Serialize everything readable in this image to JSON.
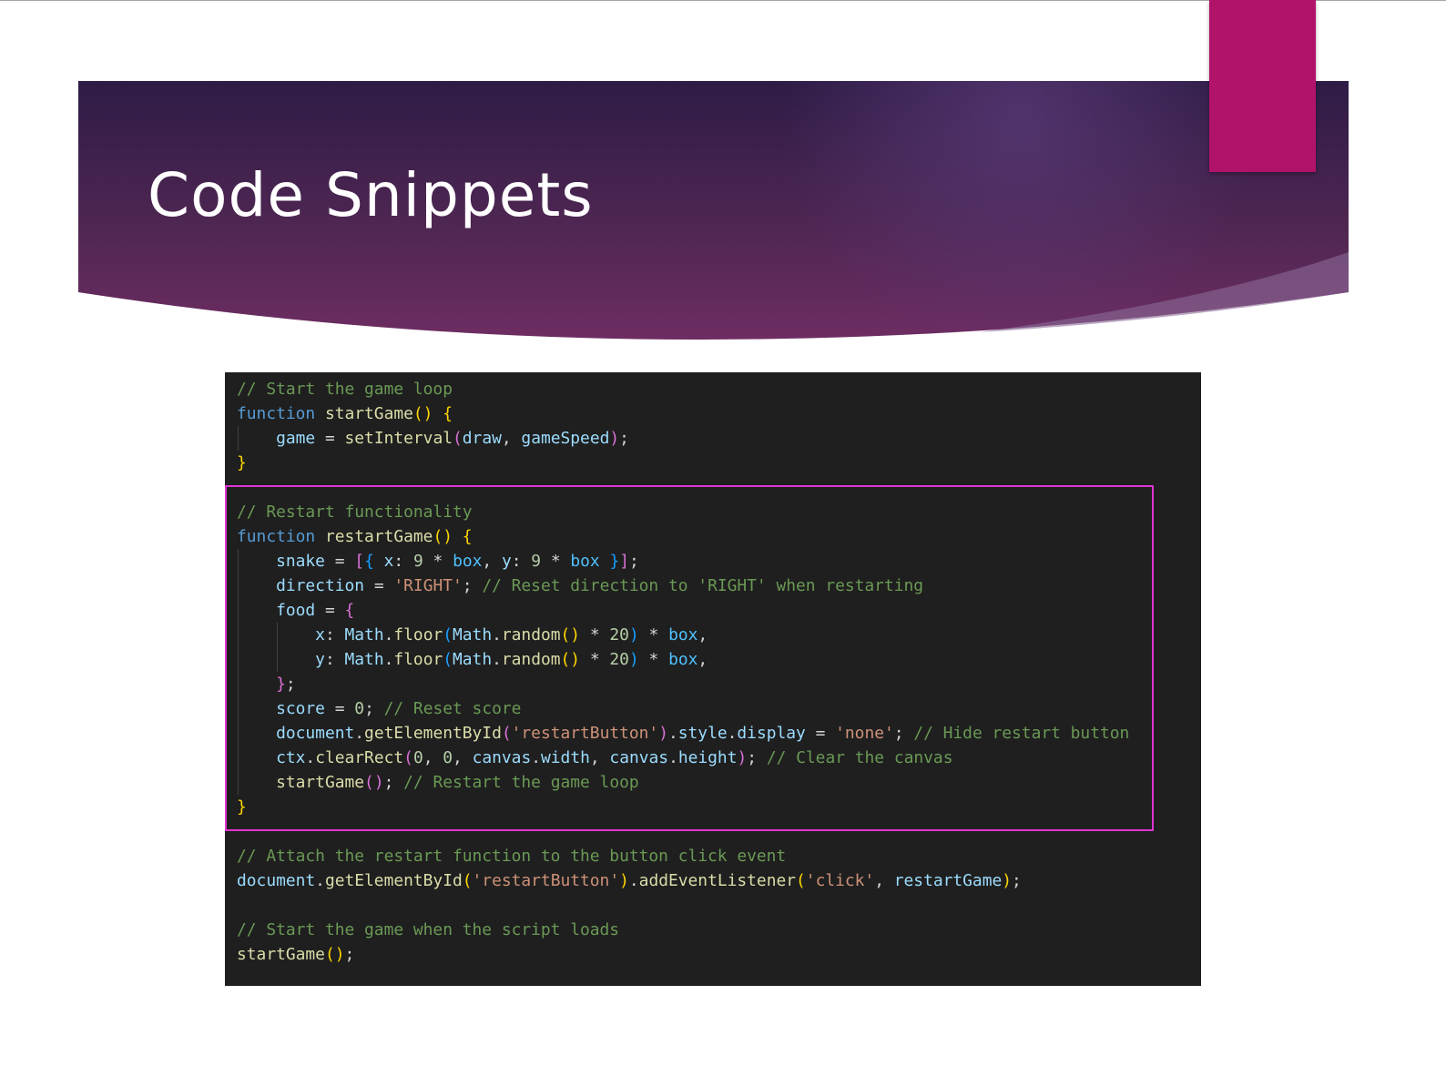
{
  "slide": {
    "title": "Code Snippets",
    "colors": {
      "banner_dark": "#2e1c46",
      "banner_mid": "#6a2c62",
      "accent_tab": "#b1136a",
      "highlight_border": "#e034d3",
      "code_background": "#1f1f1f"
    }
  },
  "code": {
    "language": "javascript",
    "lines": [
      [
        {
          "t": "// Start the game loop",
          "c": "cmt"
        }
      ],
      [
        {
          "t": "function",
          "c": "kw"
        },
        {
          "t": " "
        },
        {
          "t": "startGame",
          "c": "fn"
        },
        {
          "t": "()",
          "c": "b1"
        },
        {
          "t": " "
        },
        {
          "t": "{",
          "c": "b1"
        }
      ],
      [
        {
          "t": "    "
        },
        {
          "t": "game",
          "c": "var"
        },
        {
          "t": " = "
        },
        {
          "t": "setInterval",
          "c": "fn"
        },
        {
          "t": "(",
          "c": "b2"
        },
        {
          "t": "draw",
          "c": "var"
        },
        {
          "t": ", "
        },
        {
          "t": "gameSpeed",
          "c": "var"
        },
        {
          "t": ")",
          "c": "b2"
        },
        {
          "t": ";"
        }
      ],
      [
        {
          "t": "}",
          "c": "b1"
        }
      ],
      [],
      [
        {
          "t": "// Restart functionality",
          "c": "cmt"
        }
      ],
      [
        {
          "t": "function",
          "c": "kw"
        },
        {
          "t": " "
        },
        {
          "t": "restartGame",
          "c": "fn"
        },
        {
          "t": "()",
          "c": "b1"
        },
        {
          "t": " "
        },
        {
          "t": "{",
          "c": "b1"
        }
      ],
      [
        {
          "t": "    "
        },
        {
          "t": "snake",
          "c": "var"
        },
        {
          "t": " = "
        },
        {
          "t": "[",
          "c": "b2"
        },
        {
          "t": "{",
          "c": "b3"
        },
        {
          "t": " "
        },
        {
          "t": "x",
          "c": "var"
        },
        {
          "t": ": "
        },
        {
          "t": "9",
          "c": "num"
        },
        {
          "t": " * "
        },
        {
          "t": "box",
          "c": "const"
        },
        {
          "t": ", "
        },
        {
          "t": "y",
          "c": "var"
        },
        {
          "t": ": "
        },
        {
          "t": "9",
          "c": "num"
        },
        {
          "t": " * "
        },
        {
          "t": "box",
          "c": "const"
        },
        {
          "t": " "
        },
        {
          "t": "}",
          "c": "b3"
        },
        {
          "t": "]",
          "c": "b2"
        },
        {
          "t": ";"
        }
      ],
      [
        {
          "t": "    "
        },
        {
          "t": "direction",
          "c": "var"
        },
        {
          "t": " = "
        },
        {
          "t": "'RIGHT'",
          "c": "str"
        },
        {
          "t": "; "
        },
        {
          "t": "// Reset direction to 'RIGHT' when restarting",
          "c": "cmt"
        }
      ],
      [
        {
          "t": "    "
        },
        {
          "t": "food",
          "c": "var"
        },
        {
          "t": " = "
        },
        {
          "t": "{",
          "c": "b2"
        }
      ],
      [
        {
          "t": "        "
        },
        {
          "t": "x",
          "c": "var"
        },
        {
          "t": ": "
        },
        {
          "t": "Math",
          "c": "var"
        },
        {
          "t": "."
        },
        {
          "t": "floor",
          "c": "fn"
        },
        {
          "t": "(",
          "c": "b3"
        },
        {
          "t": "Math",
          "c": "var"
        },
        {
          "t": "."
        },
        {
          "t": "random",
          "c": "fn"
        },
        {
          "t": "()",
          "c": "b1"
        },
        {
          "t": " * "
        },
        {
          "t": "20",
          "c": "num"
        },
        {
          "t": ")",
          "c": "b3"
        },
        {
          "t": " * "
        },
        {
          "t": "box",
          "c": "const"
        },
        {
          "t": ","
        }
      ],
      [
        {
          "t": "        "
        },
        {
          "t": "y",
          "c": "var"
        },
        {
          "t": ": "
        },
        {
          "t": "Math",
          "c": "var"
        },
        {
          "t": "."
        },
        {
          "t": "floor",
          "c": "fn"
        },
        {
          "t": "(",
          "c": "b3"
        },
        {
          "t": "Math",
          "c": "var"
        },
        {
          "t": "."
        },
        {
          "t": "random",
          "c": "fn"
        },
        {
          "t": "()",
          "c": "b1"
        },
        {
          "t": " * "
        },
        {
          "t": "20",
          "c": "num"
        },
        {
          "t": ")",
          "c": "b3"
        },
        {
          "t": " * "
        },
        {
          "t": "box",
          "c": "const"
        },
        {
          "t": ","
        }
      ],
      [
        {
          "t": "    "
        },
        {
          "t": "}",
          "c": "b2"
        },
        {
          "t": ";"
        }
      ],
      [
        {
          "t": "    "
        },
        {
          "t": "score",
          "c": "var"
        },
        {
          "t": " = "
        },
        {
          "t": "0",
          "c": "num"
        },
        {
          "t": "; "
        },
        {
          "t": "// Reset score",
          "c": "cmt"
        }
      ],
      [
        {
          "t": "    "
        },
        {
          "t": "document",
          "c": "var"
        },
        {
          "t": "."
        },
        {
          "t": "getElementById",
          "c": "fn"
        },
        {
          "t": "(",
          "c": "b2"
        },
        {
          "t": "'restartButton'",
          "c": "str"
        },
        {
          "t": ")",
          "c": "b2"
        },
        {
          "t": "."
        },
        {
          "t": "style",
          "c": "var"
        },
        {
          "t": "."
        },
        {
          "t": "display",
          "c": "var"
        },
        {
          "t": " = "
        },
        {
          "t": "'none'",
          "c": "str"
        },
        {
          "t": "; "
        },
        {
          "t": "// Hide restart button",
          "c": "cmt"
        }
      ],
      [
        {
          "t": "    "
        },
        {
          "t": "ctx",
          "c": "var"
        },
        {
          "t": "."
        },
        {
          "t": "clearRect",
          "c": "fn"
        },
        {
          "t": "(",
          "c": "b2"
        },
        {
          "t": "0",
          "c": "num"
        },
        {
          "t": ", "
        },
        {
          "t": "0",
          "c": "num"
        },
        {
          "t": ", "
        },
        {
          "t": "canvas",
          "c": "var"
        },
        {
          "t": "."
        },
        {
          "t": "width",
          "c": "var"
        },
        {
          "t": ", "
        },
        {
          "t": "canvas",
          "c": "var"
        },
        {
          "t": "."
        },
        {
          "t": "height",
          "c": "var"
        },
        {
          "t": ")",
          "c": "b2"
        },
        {
          "t": "; "
        },
        {
          "t": "// Clear the canvas",
          "c": "cmt"
        }
      ],
      [
        {
          "t": "    "
        },
        {
          "t": "startGame",
          "c": "fn"
        },
        {
          "t": "()",
          "c": "b2"
        },
        {
          "t": "; "
        },
        {
          "t": "// Restart the game loop",
          "c": "cmt"
        }
      ],
      [
        {
          "t": "}",
          "c": "b1"
        }
      ],
      [],
      [
        {
          "t": "// Attach the restart function to the button click event",
          "c": "cmt"
        }
      ],
      [
        {
          "t": "document",
          "c": "var"
        },
        {
          "t": "."
        },
        {
          "t": "getElementById",
          "c": "fn"
        },
        {
          "t": "(",
          "c": "b1"
        },
        {
          "t": "'restartButton'",
          "c": "str"
        },
        {
          "t": ")",
          "c": "b1"
        },
        {
          "t": "."
        },
        {
          "t": "addEventListener",
          "c": "fn"
        },
        {
          "t": "(",
          "c": "b1"
        },
        {
          "t": "'click'",
          "c": "str"
        },
        {
          "t": ", "
        },
        {
          "t": "restartGame",
          "c": "var"
        },
        {
          "t": ")",
          "c": "b1"
        },
        {
          "t": ";"
        }
      ],
      [],
      [
        {
          "t": "// Start the game when the script loads",
          "c": "cmt"
        }
      ],
      [
        {
          "t": "startGame",
          "c": "fn"
        },
        {
          "t": "()",
          "c": "b1"
        },
        {
          "t": ";"
        }
      ]
    ]
  }
}
